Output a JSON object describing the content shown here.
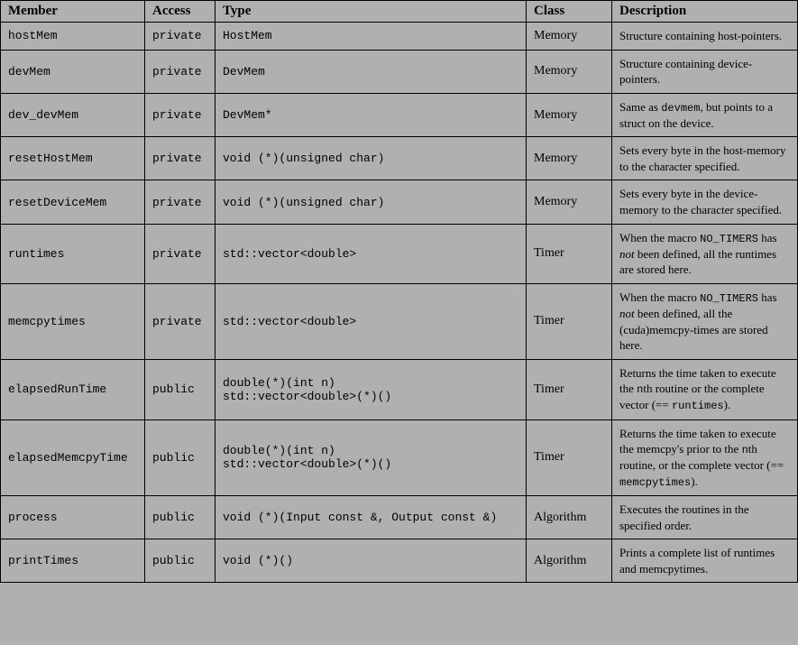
{
  "headers": {
    "member": "Member",
    "access": "Access",
    "type": "Type",
    "class": "Class",
    "description": "Description"
  },
  "rows": [
    {
      "member": "hostMem",
      "access": "private",
      "type": "HostMem",
      "class": "Memory",
      "description": "Structure containing host-pointers."
    },
    {
      "member": "devMem",
      "access": "private",
      "type": "DevMem",
      "class": "Memory",
      "description": "Structure containing device-pointers."
    },
    {
      "member": "dev_devMem",
      "access": "private",
      "type": "DevMem*",
      "class": "Memory",
      "description": "Same as <code>devmem</code>, but points to a struct on the device."
    },
    {
      "member": "resetHostMem",
      "access": "private",
      "type": "void (*)(unsigned char)",
      "class": "Memory",
      "description": "Sets every byte in the host-memory to the character specified."
    },
    {
      "member": "resetDeviceMem",
      "access": "private",
      "type": "void (*)(unsigned char)",
      "class": "Memory",
      "description": "Sets every byte in the device-memory to the character specified."
    },
    {
      "member": "runtimes",
      "access": "private",
      "type": "std::vector<double>",
      "class": "Timer",
      "description": "When the macro <code>NO_TIMERS</code> has <em>not</em> been defined, all the runtimes are stored here."
    },
    {
      "member": "memcpytimes",
      "access": "private",
      "type": "std::vector<double>",
      "class": "Timer",
      "description": "When the macro <code>NO_TIMERS</code> has <em>not</em> been defined, all the (cuda)memcpy-times are stored here."
    },
    {
      "member": "elapsedRunTime",
      "access": "public",
      "type": "double(*)(int n)\nstd::vector<double>(*)()",
      "class": "Timer",
      "description": "Returns the time taken to execute the <code>n</code>th routine or the complete vector (== <code>runtimes</code>)."
    },
    {
      "member": "elapsedMemcpyTime",
      "access": "public",
      "type": "double(*)(int n)\nstd::vector<double>(*)()",
      "class": "Timer",
      "description": "Returns the time taken to execute the memcpy's prior to the <code>n</code>th routine, or the complete vector (== <code>memcpytimes</code>)."
    },
    {
      "member": "process",
      "access": "public",
      "type": "void (*)(Input const &, Output const &)",
      "class": "Algorithm",
      "description": "Executes the routines in the specified order."
    },
    {
      "member": "printTimes",
      "access": "public",
      "type": "void (*)()",
      "class": "Algorithm",
      "description": "Prints a complete list of runtimes and memcpytimes."
    }
  ]
}
